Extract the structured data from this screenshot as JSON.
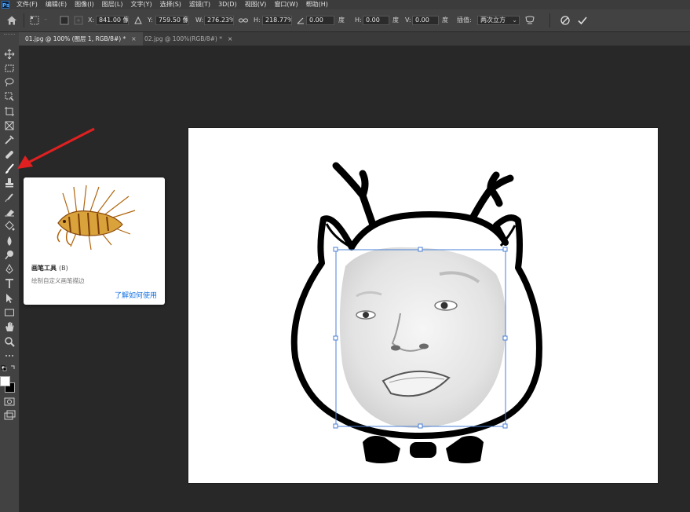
{
  "app": {
    "logo_text": "Ps",
    "menus": [
      "文件(F)",
      "编辑(E)",
      "图像(I)",
      "图层(L)",
      "文字(Y)",
      "选择(S)",
      "滤镜(T)",
      "3D(D)",
      "视图(V)",
      "窗口(W)",
      "帮助(H)"
    ]
  },
  "options": {
    "x_label": "X:",
    "x_value": "841.00 像素",
    "y_label": "Y:",
    "y_value": "759.50 像素",
    "w_label": "W:",
    "w_value": "276.23%",
    "h_label": "H:",
    "h_value": "218.77%",
    "angle_value": "0.00",
    "angle_unit": "度",
    "hskew_label": "H:",
    "hskew_value": "0.00",
    "hskew_unit": "度",
    "vskew_label": "V:",
    "vskew_value": "0.00",
    "vskew_unit": "度",
    "interp_label": "插值:",
    "interp_value": "两次立方"
  },
  "tabs": [
    {
      "label": "01.jpg @ 100% (图层 1, RGB/8#) *",
      "close": "×"
    },
    {
      "label": "02.jpg @ 100%(RGB/8#) *",
      "close": "×"
    }
  ],
  "tooltip": {
    "title": "画笔工具",
    "shortcut": "(B)",
    "description": "绘制自定义画笔描边",
    "link": "了解如何使用"
  },
  "colors": {
    "accent": "#1473e6",
    "annotation_arrow": "#e02020",
    "transform_box": "#4a7fd6",
    "foreground": "#ffffff",
    "background": "#000000"
  }
}
